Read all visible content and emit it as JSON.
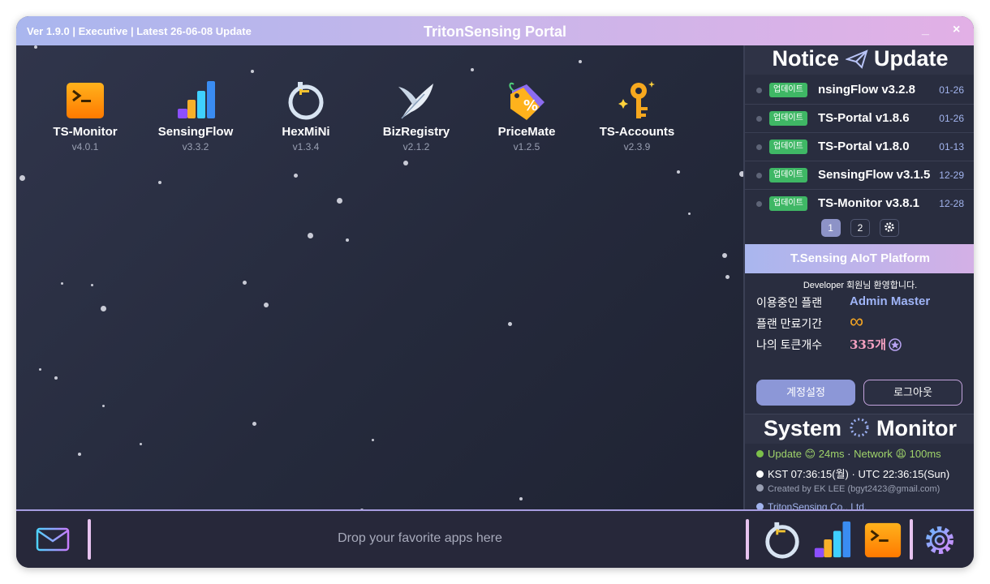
{
  "window": {
    "version_text": "Ver 1.9.0 | Executive | Latest 26-06-08 Update",
    "title": "TritonSensing Portal",
    "minimize_label": "_",
    "close_label": "×"
  },
  "apps": [
    {
      "name": "TS-Monitor",
      "version": "v4.0.1",
      "icon": "terminal-icon"
    },
    {
      "name": "SensingFlow",
      "version": "v3.3.2",
      "icon": "bar-chart-icon"
    },
    {
      "name": "HexMiNi",
      "version": "v1.3.4",
      "icon": "cable-ring-icon"
    },
    {
      "name": "BizRegistry",
      "version": "v2.1.2",
      "icon": "feather-icon"
    },
    {
      "name": "PriceMate",
      "version": "v1.2.5",
      "icon": "price-tag-icon"
    },
    {
      "name": "TS-Accounts",
      "version": "v2.3.9",
      "icon": "key-icon"
    }
  ],
  "notice": {
    "title_left": "Notice",
    "title_right": "Update",
    "icon": "paper-plane-icon",
    "items": [
      {
        "badge": "업데이트",
        "title": "nsingFlow v3.2.8",
        "date": "01-26"
      },
      {
        "badge": "업데이트",
        "title": "TS-Portal v1.8.6",
        "date": "01-26"
      },
      {
        "badge": "업데이트",
        "title": "TS-Portal v1.8.0",
        "date": "01-13"
      },
      {
        "badge": "업데이트",
        "title": "SensingFlow v3.1.5",
        "date": "12-29"
      },
      {
        "badge": "업데이트",
        "title": "TS-Monitor v3.8.1",
        "date": "12-28"
      }
    ],
    "pages": [
      "1",
      "2"
    ],
    "current_page": "1"
  },
  "platform": {
    "title": "T.Sensing AIoT Platform",
    "welcome": "Developer 회원님 환영합니다.",
    "plan_label": "이용중인 플랜",
    "plan_value": "Admin Master",
    "expiry_label": "플랜 만료기간",
    "expiry_value": "∞",
    "tokens_label": "나의 토큰개수",
    "tokens_value": "335개",
    "account_button": "계정설정",
    "logout_button": "로그아웃"
  },
  "system": {
    "title_left": "System",
    "title_right": "Monitor",
    "update_label": "Update",
    "update_emoji": "😊",
    "update_ms": "24ms",
    "network_label": "Network",
    "network_emoji": "😩",
    "network_ms": "100ms",
    "separator": "·",
    "kst_time": "KST 07:36:15(월)",
    "utc_time": "UTC 22:36:15(Sun)",
    "created_by": "Created by EK LEE (bgyt2423@gmail.com)",
    "company": "TritonSensing Co., Ltd."
  },
  "dock": {
    "hint": "Drop your favorite apps here",
    "pinned": [
      "cable-ring-icon",
      "bar-chart-icon",
      "terminal-icon"
    ]
  },
  "colors": {
    "accent_purple": "#a9b6ee",
    "badge_green": "#3fb765",
    "token_pink": "#f4a0c0",
    "infinity_orange": "#f5a623",
    "plan_blue": "#9fb4f7",
    "status_green": "#7cc04a",
    "date_blue": "#a2b4ee"
  }
}
